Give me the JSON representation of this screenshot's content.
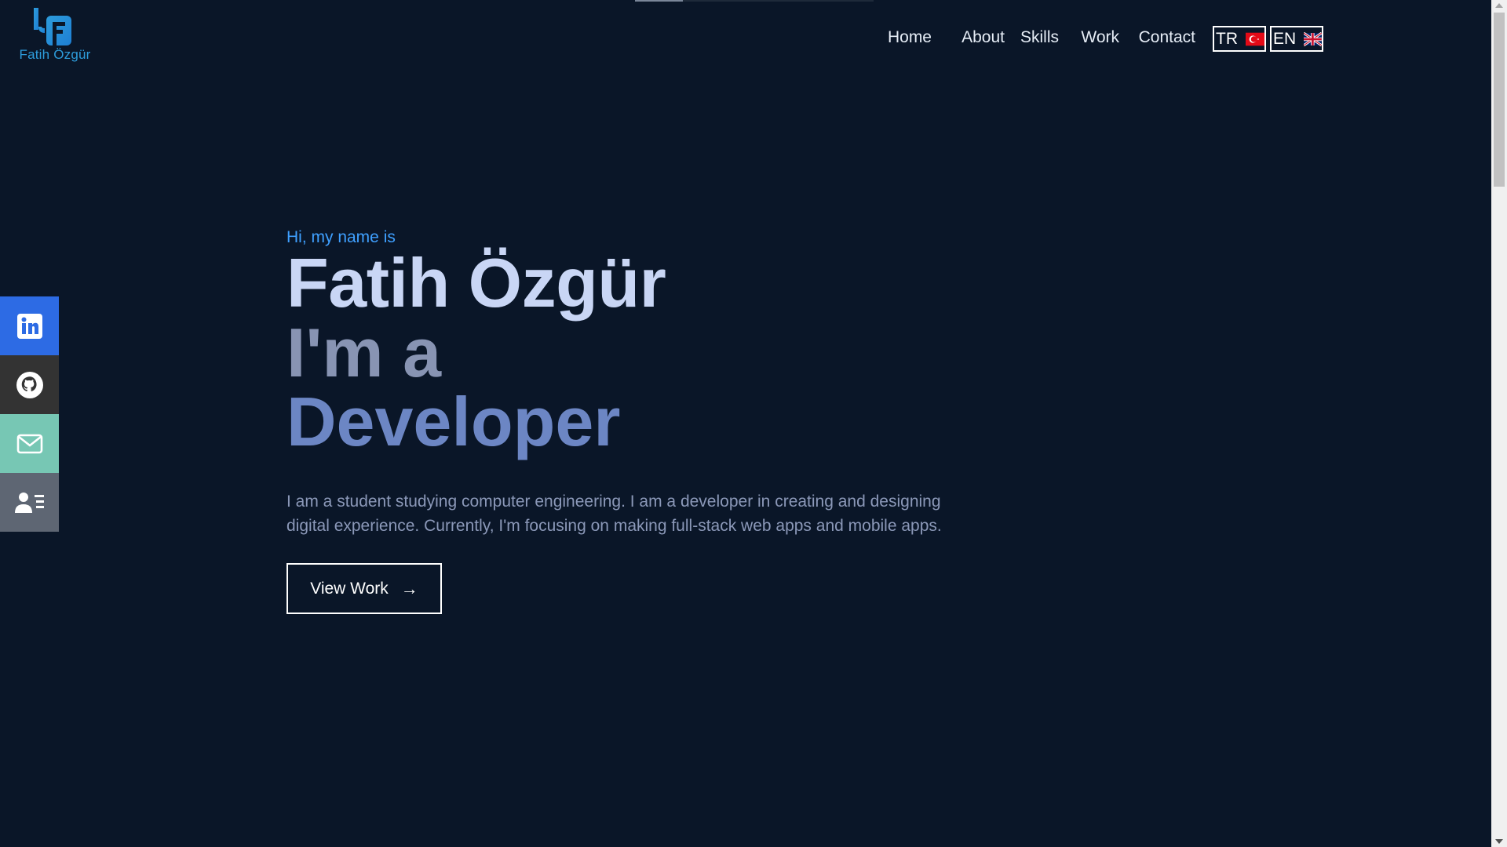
{
  "logo": {
    "text": "Fatih Özgür",
    "icon": "fo-monogram-icon",
    "color": "#2d9cdb"
  },
  "nav": {
    "items": [
      {
        "label": "Home"
      },
      {
        "label": "About"
      },
      {
        "label": "Skills"
      },
      {
        "label": "Work"
      },
      {
        "label": "Contact"
      }
    ],
    "languages": [
      {
        "label": "TR",
        "icon": "turkey-flag-icon"
      },
      {
        "label": "EN",
        "icon": "uk-flag-icon"
      }
    ]
  },
  "social": [
    {
      "icon": "linkedin-icon",
      "color": "#2d6be4"
    },
    {
      "icon": "github-icon",
      "color": "#333333"
    },
    {
      "icon": "mail-icon",
      "color": "#77c7b4"
    },
    {
      "icon": "contact-card-icon",
      "color": "#5e6673"
    }
  ],
  "hero": {
    "greeting": "Hi, my name is",
    "name": "Fatih Özgür",
    "role_prefix": "I'm a",
    "role_word": "Developer",
    "bio": "I am a student studying computer engineering. I am a developer in creating and designing digital experience. Currently, I'm focusing on making full-stack web apps and mobile apps.",
    "cta_label": "View Work",
    "cta_icon": "arrow-right-icon"
  },
  "colors": {
    "background": "#0a1628",
    "accent": "#3fa0ff",
    "name": "#c9d6f5",
    "role_word": "#6c86c4"
  },
  "scroll_progress": 0.2
}
